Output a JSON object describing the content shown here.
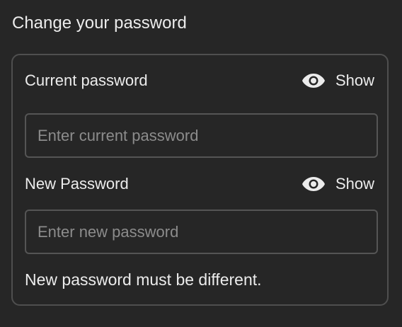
{
  "page": {
    "title": "Change your password"
  },
  "current_password": {
    "label": "Current password",
    "toggle_label": "Show",
    "toggle_icon": "eye-icon",
    "placeholder": "Enter current password",
    "value": ""
  },
  "new_password": {
    "label": "New Password",
    "toggle_label": "Show",
    "toggle_icon": "eye-icon",
    "placeholder": "Enter new password",
    "value": ""
  },
  "helper": {
    "text": "New password must be different."
  },
  "colors": {
    "background": "#262626",
    "border": "#4f4f4f",
    "text": "#ececec",
    "placeholder": "#8c8c8c"
  }
}
